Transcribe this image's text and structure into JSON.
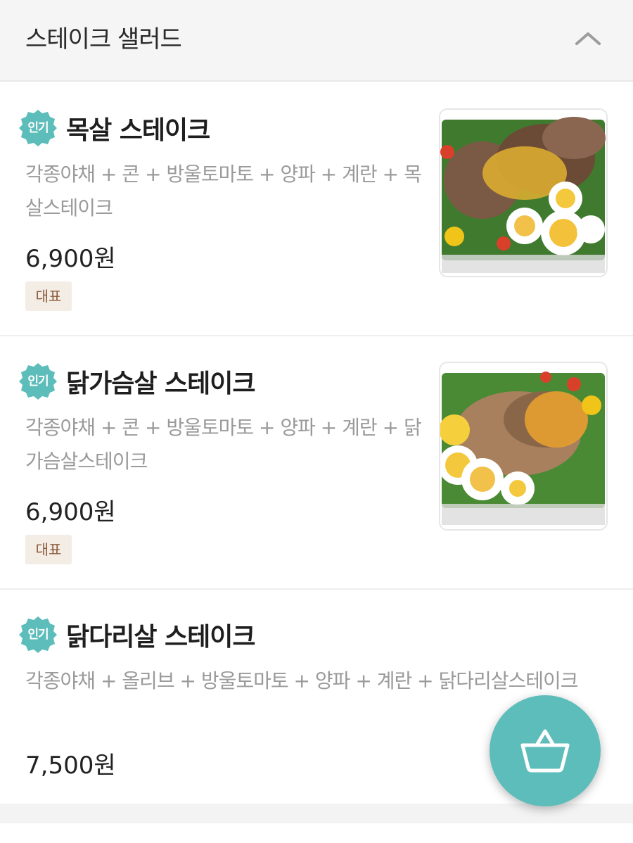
{
  "section": {
    "title": "스테이크 샐러드",
    "toggle_icon": "chevron-up-icon"
  },
  "menu_items": [
    {
      "badge": "인기",
      "name": "목살 스테이크",
      "description": "각종야채 + 콘 + 방울토마토 + 양파 + 계란 + 목살스테이크",
      "price": "6,900원",
      "tag": "대표"
    },
    {
      "badge": "인기",
      "name": "닭가슴살 스테이크",
      "description": "각종야채 + 콘 + 방울토마토 + 양파 + 계란 + 닭가슴살스테이크",
      "price": "6,900원",
      "tag": "대표"
    },
    {
      "badge": "인기",
      "name": "닭다리살 스테이크",
      "description": "각종야채 + 올리브 + 방울토마토 + 양파 + 계란 + 닭다리살스테이크",
      "price": "7,500원"
    }
  ],
  "cart": {
    "icon": "shopping-basket-icon"
  },
  "colors": {
    "accent": "#5dbdba",
    "tag_bg": "#f3ede6",
    "tag_text": "#8a5a3a",
    "description": "#9a9a9a"
  }
}
